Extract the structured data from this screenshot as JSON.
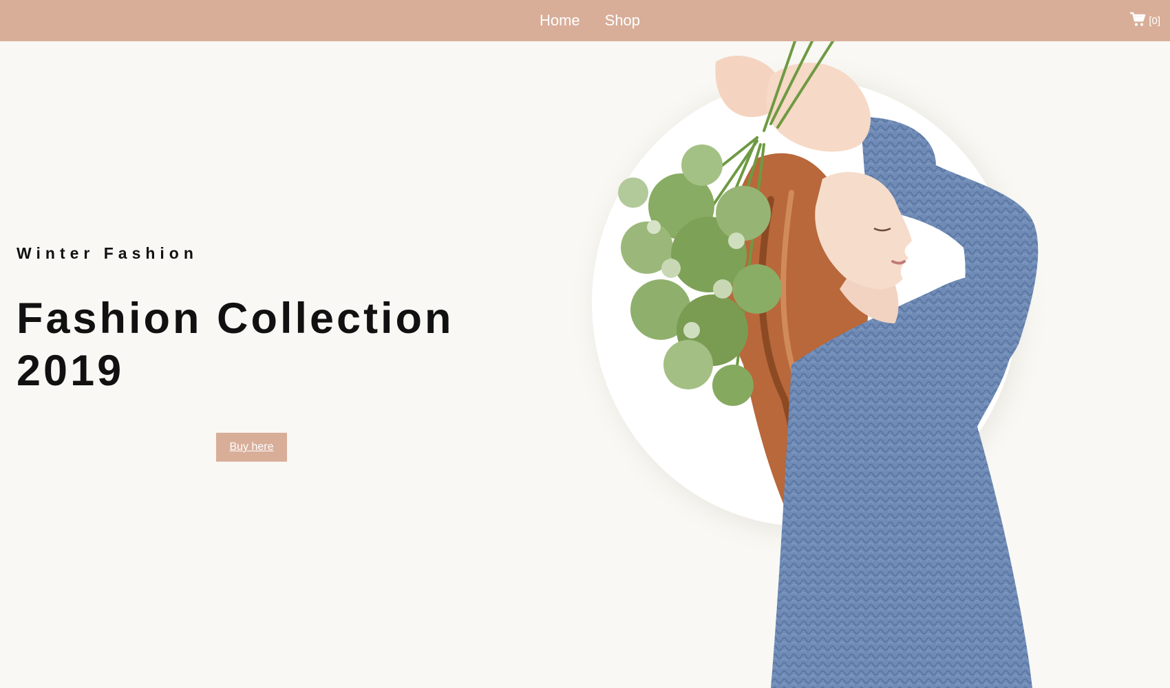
{
  "nav": {
    "links": [
      "Home",
      "Shop"
    ],
    "cart_count": "[0]"
  },
  "hero": {
    "subtitle": "Winter Fashion",
    "title_line1": "Fashion Collection",
    "title_line2": "2019",
    "cta_label": "Buy here"
  },
  "colors": {
    "brand": "#d8ae99",
    "background": "#f9f8f4",
    "text": "#111111",
    "sweater": "#6f8bb6"
  },
  "icons": {
    "cart": "shopping-cart-icon"
  }
}
